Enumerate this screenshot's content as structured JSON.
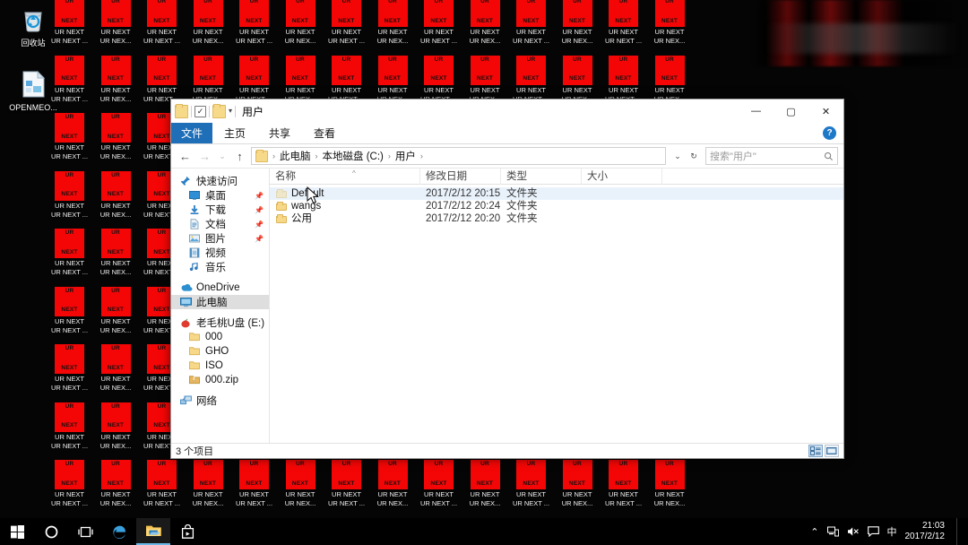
{
  "desktop": {
    "icons": [
      {
        "name": "回收站",
        "icon": "recycle-bin-icon"
      },
      {
        "name": "OPENMEO...",
        "icon": "document-icon"
      }
    ],
    "ransom_tile": {
      "line1": "UR",
      "line2": "NEXT",
      "label_a": "UR NEXT",
      "label_b": "UR NEXT ...",
      "label_b_alt": "UR NEX...",
      "color": "#f50606",
      "count_cols": 14,
      "count_rows": 9
    }
  },
  "explorer": {
    "title": "用户",
    "quick_access_toolbar": {
      "folder_icon": "folder-icon",
      "properties_icon": "properties-checkbox-icon",
      "new_folder_icon": "new-folder-icon",
      "customize_caret": "▾"
    },
    "window_controls": {
      "minimize": "—",
      "maximize": "▢",
      "close": "✕"
    },
    "ribbon": {
      "tabs": [
        {
          "label": "文件",
          "active_style": "file"
        },
        {
          "label": "主页",
          "active_style": "normal"
        },
        {
          "label": "共享",
          "active_style": "normal"
        },
        {
          "label": "查看",
          "active_style": "normal"
        }
      ],
      "help_label": "?"
    },
    "navigation": {
      "back": "←",
      "forward": "→",
      "recent": "⌄",
      "up": "↑",
      "refresh": "↻",
      "history_caret": "⌄",
      "breadcrumbs": [
        "此电脑",
        "本地磁盘 (C:)",
        "用户"
      ],
      "separator": "›"
    },
    "search": {
      "placeholder": "搜索\"用户\"",
      "icon": "search-icon"
    },
    "nav_pane": [
      {
        "label": "快速访问",
        "icon": "pin-star-icon",
        "pinned": false,
        "indent": false,
        "selected": false
      },
      {
        "label": "桌面",
        "icon": "desktop-icon",
        "pinned": true,
        "indent": true,
        "selected": false
      },
      {
        "label": "下载",
        "icon": "downloads-icon",
        "pinned": true,
        "indent": true,
        "selected": false
      },
      {
        "label": "文档",
        "icon": "documents-icon",
        "pinned": true,
        "indent": true,
        "selected": false
      },
      {
        "label": "图片",
        "icon": "pictures-icon",
        "pinned": true,
        "indent": true,
        "selected": false
      },
      {
        "label": "视频",
        "icon": "videos-icon",
        "pinned": false,
        "indent": true,
        "selected": false
      },
      {
        "label": "音乐",
        "icon": "music-icon",
        "pinned": false,
        "indent": true,
        "selected": false
      },
      {
        "label": "OneDrive",
        "icon": "onedrive-icon",
        "pinned": false,
        "indent": false,
        "selected": false
      },
      {
        "label": "此电脑",
        "icon": "this-pc-icon",
        "pinned": false,
        "indent": false,
        "selected": true
      },
      {
        "label": "老毛桃U盘 (E:)",
        "icon": "usb-drive-icon",
        "pinned": false,
        "indent": false,
        "selected": false
      },
      {
        "label": "000",
        "icon": "folder-icon",
        "pinned": false,
        "indent": true,
        "selected": false
      },
      {
        "label": "GHO",
        "icon": "folder-icon",
        "pinned": false,
        "indent": true,
        "selected": false
      },
      {
        "label": "ISO",
        "icon": "folder-icon",
        "pinned": false,
        "indent": true,
        "selected": false
      },
      {
        "label": "000.zip",
        "icon": "zip-icon",
        "pinned": false,
        "indent": true,
        "selected": false
      },
      {
        "label": "网络",
        "icon": "network-icon",
        "pinned": false,
        "indent": false,
        "selected": false
      }
    ],
    "columns": [
      {
        "label": "名称",
        "key": "name"
      },
      {
        "label": "修改日期",
        "key": "date"
      },
      {
        "label": "类型",
        "key": "type"
      },
      {
        "label": "大小",
        "key": "size"
      }
    ],
    "sort_indicator": "^",
    "rows": [
      {
        "name": "Default",
        "date": "2017/2/12 20:15",
        "type": "文件夹",
        "size": "",
        "selected": true,
        "hidden_attr": true
      },
      {
        "name": "wangs",
        "date": "2017/2/12 20:24",
        "type": "文件夹",
        "size": "",
        "selected": false,
        "hidden_attr": false
      },
      {
        "name": "公用",
        "date": "2017/2/12 20:20",
        "type": "文件夹",
        "size": "",
        "selected": false,
        "hidden_attr": false
      }
    ],
    "status": {
      "item_count": "3 个项目",
      "view_details_icon": "details-view-icon",
      "view_tiles_icon": "large-icons-view-icon"
    }
  },
  "taskbar": {
    "buttons": [
      {
        "name": "start-button",
        "glyph": "⊞"
      },
      {
        "name": "cortana-button",
        "glyph": "◯"
      },
      {
        "name": "task-view-button",
        "glyph": "❐"
      },
      {
        "name": "edge-button",
        "glyph": "e"
      },
      {
        "name": "file-explorer-button",
        "glyph": "📁"
      },
      {
        "name": "store-button",
        "glyph": "🛍"
      }
    ],
    "tray": {
      "chevron": "⌃",
      "network": "🖧",
      "volume": "🔇",
      "action_center": "🗨",
      "ime": "中",
      "time": "21:03",
      "date": "2017/2/12"
    }
  }
}
